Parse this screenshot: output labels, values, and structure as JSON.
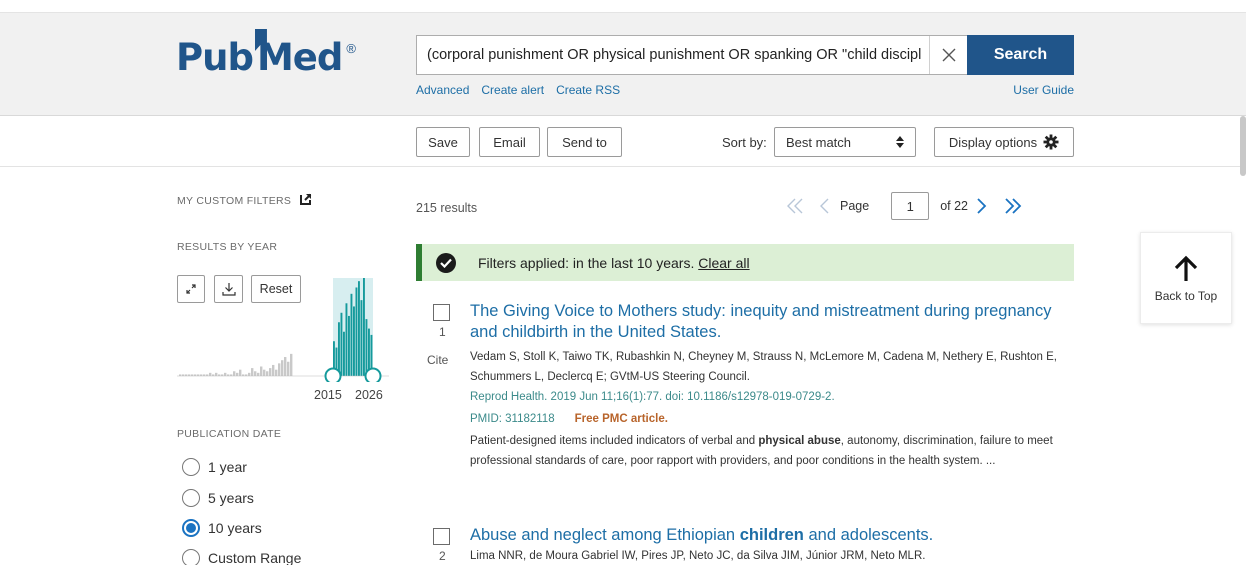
{
  "header": {
    "logo": {
      "pub": "Pub",
      "med": "Med",
      "registered": "®"
    },
    "search": {
      "value": "(corporal punishment OR physical punishment OR spanking OR \"child discipl",
      "button_label": "Search"
    },
    "links": [
      "Advanced",
      "Create alert",
      "Create RSS"
    ],
    "user_guide": "User Guide"
  },
  "toolbar": {
    "save": "Save",
    "email": "Email",
    "send_to": "Send to",
    "sort_by_label": "Sort by:",
    "sort_value": "Best match",
    "display_options": "Display options"
  },
  "sidebar": {
    "custom_filters": "MY CUSTOM FILTERS",
    "results_by_year": "RESULTS BY YEAR",
    "reset": "Reset",
    "year_start": "2015",
    "year_end": "2026",
    "publication_date": "PUBLICATION DATE",
    "date_options": [
      {
        "label": "1 year",
        "selected": false
      },
      {
        "label": "5 years",
        "selected": false
      },
      {
        "label": "10 years",
        "selected": true
      },
      {
        "label": "Custom Range",
        "selected": false
      }
    ]
  },
  "histogram": {
    "bars_gray": [
      1,
      1,
      1,
      1,
      1,
      1,
      1,
      1,
      1,
      1,
      2,
      1,
      2,
      1,
      1,
      2,
      1,
      1,
      3,
      2,
      4,
      1,
      1,
      2,
      5,
      3,
      2,
      6,
      4,
      3,
      5,
      7,
      4,
      8,
      10,
      12,
      9,
      14
    ],
    "bars_teal": [
      22,
      18,
      34,
      40,
      28,
      46,
      38,
      52,
      44,
      56,
      60,
      48,
      62,
      36,
      30,
      26
    ]
  },
  "results": {
    "count": "215 results",
    "page_label": "Page",
    "page": "1",
    "of": "of 22",
    "filter_notice": "Filters applied: in the last 10 years.",
    "clear_all": "Clear all"
  },
  "articles": [
    {
      "num": "1",
      "cite": "Cite",
      "title": "The Giving Voice to Mothers study: inequity and mistreatment during pregnancy and childbirth in the United States.",
      "authors": "Vedam S, Stoll K, Taiwo TK, Rubashkin N, Cheyney M, Strauss N, McLemore M, Cadena M, Nethery E, Rushton E, Schummers L, Declercq E; GVtM-US Steering Council.",
      "journal": "Reprod Health. 2019 Jun 11;16(1):77. doi: 10.1186/s12978-019-0729-2.",
      "pmid": "PMID: 31182118",
      "free": "Free PMC article.",
      "snippet_a": "Patient-designed items included indicators of verbal and ",
      "snippet_bold": "physical abuse",
      "snippet_b": ", autonomy, discrimination, failure to meet professional standards of care, poor rapport with providers, and poor conditions in the health system. ..."
    },
    {
      "num": "2",
      "title_a": "Abuse and neglect among Ethiopian ",
      "title_bold": "children",
      "title_b": " and adolescents.",
      "authors": "Lima NNR, de Moura Gabriel IW, Pires JP, Neto JC, da Silva JIM, Júnior JRM, Neto MLR."
    }
  ],
  "back_to_top": "Back to Top"
}
